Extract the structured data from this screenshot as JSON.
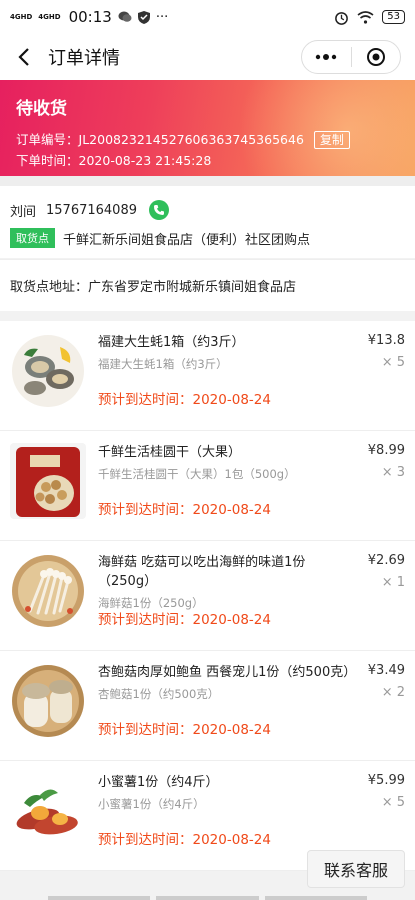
{
  "statusbar": {
    "net1": "4GHD",
    "net2": "4GHD",
    "time": "00:13",
    "battery": "53"
  },
  "nav": {
    "title": "订单详情"
  },
  "order": {
    "status": "待收货",
    "number_label": "订单编号：",
    "number": "JL200823214527606363745365646",
    "copy": "复制",
    "time_label": "下单时间：",
    "time": "2020-08-23 21:45:28"
  },
  "contact": {
    "name": "刘间",
    "phone": "15767164089",
    "tag": "取货点",
    "store": "千鲜汇新乐间姐食品店（便利）社区团购点"
  },
  "address": "取货点地址：广东省罗定市附城新乐镇间姐食品店",
  "eta_label": "预计到达时间：",
  "items": [
    {
      "name": "福建大生蚝1箱（约3斤）",
      "spec": "福建大生蚝1箱（约3斤）",
      "price": "¥13.8",
      "qty": "× 5",
      "eta": "2020-08-24",
      "icon": "oyster-image"
    },
    {
      "name": "千鲜生活桂圆干（大果）",
      "spec": "千鲜生活桂圆干（大果）1包（500g）",
      "price": "¥8.99",
      "qty": "× 3",
      "eta": "2020-08-24",
      "icon": "longan-image"
    },
    {
      "name": "海鲜菇 吃菇可以吃出海鲜的味道1份（250g）",
      "spec": "海鲜菇1份（250g）",
      "price": "¥2.69",
      "qty": "× 1",
      "eta": "2020-08-24",
      "icon": "mushroom-image"
    },
    {
      "name": "杏鲍菇肉厚如鲍鱼 西餐宠儿1份（约500克）",
      "spec": "杏鲍菇1份（约500克）",
      "price": "¥3.49",
      "qty": "× 2",
      "eta": "2020-08-24",
      "icon": "king-oyster-image"
    },
    {
      "name": "小蜜薯1份（约4斤）",
      "spec": "小蜜薯1份（约4斤）",
      "price": "¥5.99",
      "qty": "× 5",
      "eta": "2020-08-24",
      "icon": "sweet-potato-image"
    }
  ],
  "service_button": "联系客服"
}
